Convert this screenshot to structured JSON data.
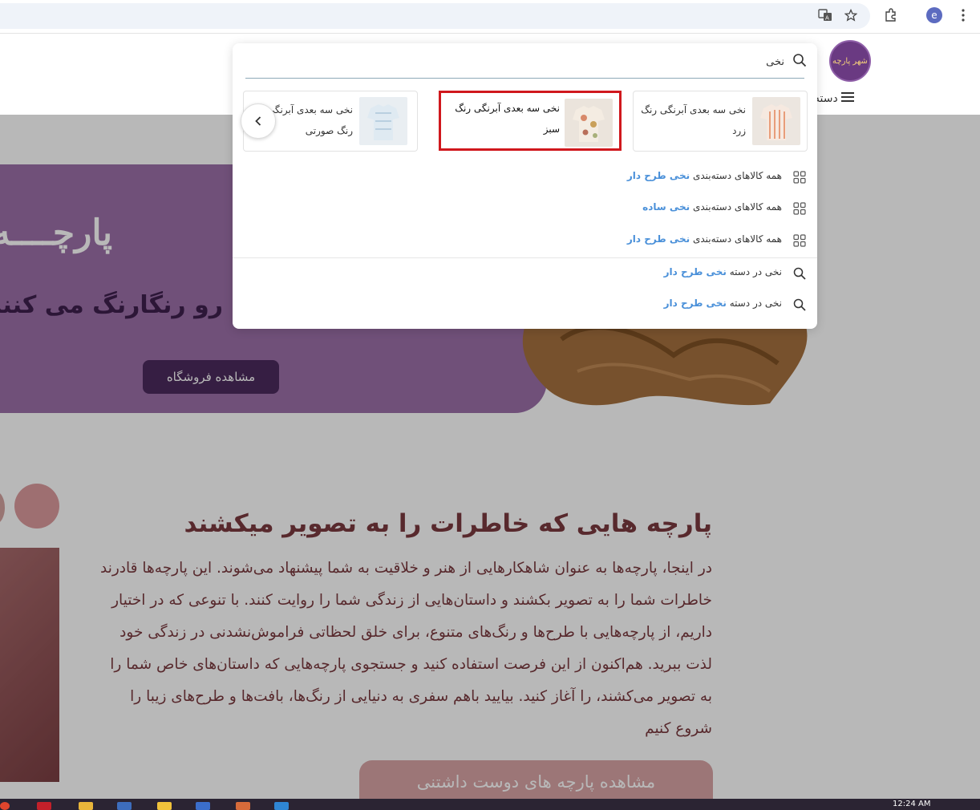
{
  "browser": {
    "icons": [
      "translate-icon",
      "bookmark-star-icon",
      "extensions-icon",
      "profile-avatar",
      "more-menu-icon"
    ],
    "profile_initial": "e"
  },
  "header": {
    "logo_text": "شهر پارچه",
    "category_menu_label": "دسته"
  },
  "hero": {
    "title": "پارچــــه یـــزد",
    "subtitle": "رو رنگارنگ می کنند",
    "button_label": "مشاهده فروشگاه"
  },
  "section": {
    "title": "پارچه هایی که خاطرات را به تصویر میکشند",
    "body": "در اینجا، پارچه‌ها به عنوان شاهکارهایی از هنر و خلاقیت به شما پیشنهاد می‌شوند. این پارچه‌ها قادرند خاطرات شما را به تصویر بکشند و داستان‌هایی از زندگی شما را روایت کنند. با تنوعی که در اختیار داریم، از پارچه‌هایی با طرح‌ها و رنگ‌های متنوع، برای خلق لحظاتی فراموش‌نشدنی در زندگی خود لذت ببرید. هم‌اکنون از این فرصت استفاده کنید و جستجوی پارچه‌هایی که داستان‌های خاص شما را به تصویر می‌کشند، را آغاز کنید. بیایید باهم سفری به دنیایی از رنگ‌ها، بافت‌ها و طرح‌های زیبا را شروع کنیم",
    "button_label": "مشاهده پارچه های دوست داشتنی"
  },
  "search": {
    "query": "نخی",
    "products": [
      {
        "name": "نخی سه بعدی آبرنگی رنگ زرد",
        "selected": false
      },
      {
        "name": "نخی سه بعدی آبرنگی رنگ سبز",
        "selected": true
      },
      {
        "name": "نخی سه بعدی آبرنگی رنگ صورتی",
        "selected": false
      }
    ],
    "category_suggestions": [
      {
        "prefix": "همه کالاهای دسته‌بندی",
        "highlight": "نخی طرح دار"
      },
      {
        "prefix": "همه کالاهای دسته‌بندی",
        "highlight": "نخی ساده"
      },
      {
        "prefix": "همه کالاهای دسته‌بندی",
        "highlight": "نخی طرح دار"
      }
    ],
    "query_suggestions": [
      {
        "prefix": "نخی در دسته",
        "highlight": "نخی طرح دار"
      },
      {
        "prefix": "نخی در دسته",
        "highlight": "نخی طرح دار"
      }
    ]
  },
  "taskbar": {
    "time": "12:24 AM"
  },
  "colors": {
    "selected_border": "#d0181d",
    "highlight": "#4a90d9",
    "hero_purple": "#9b6fa8",
    "text_maroon": "#7a3a3f"
  }
}
